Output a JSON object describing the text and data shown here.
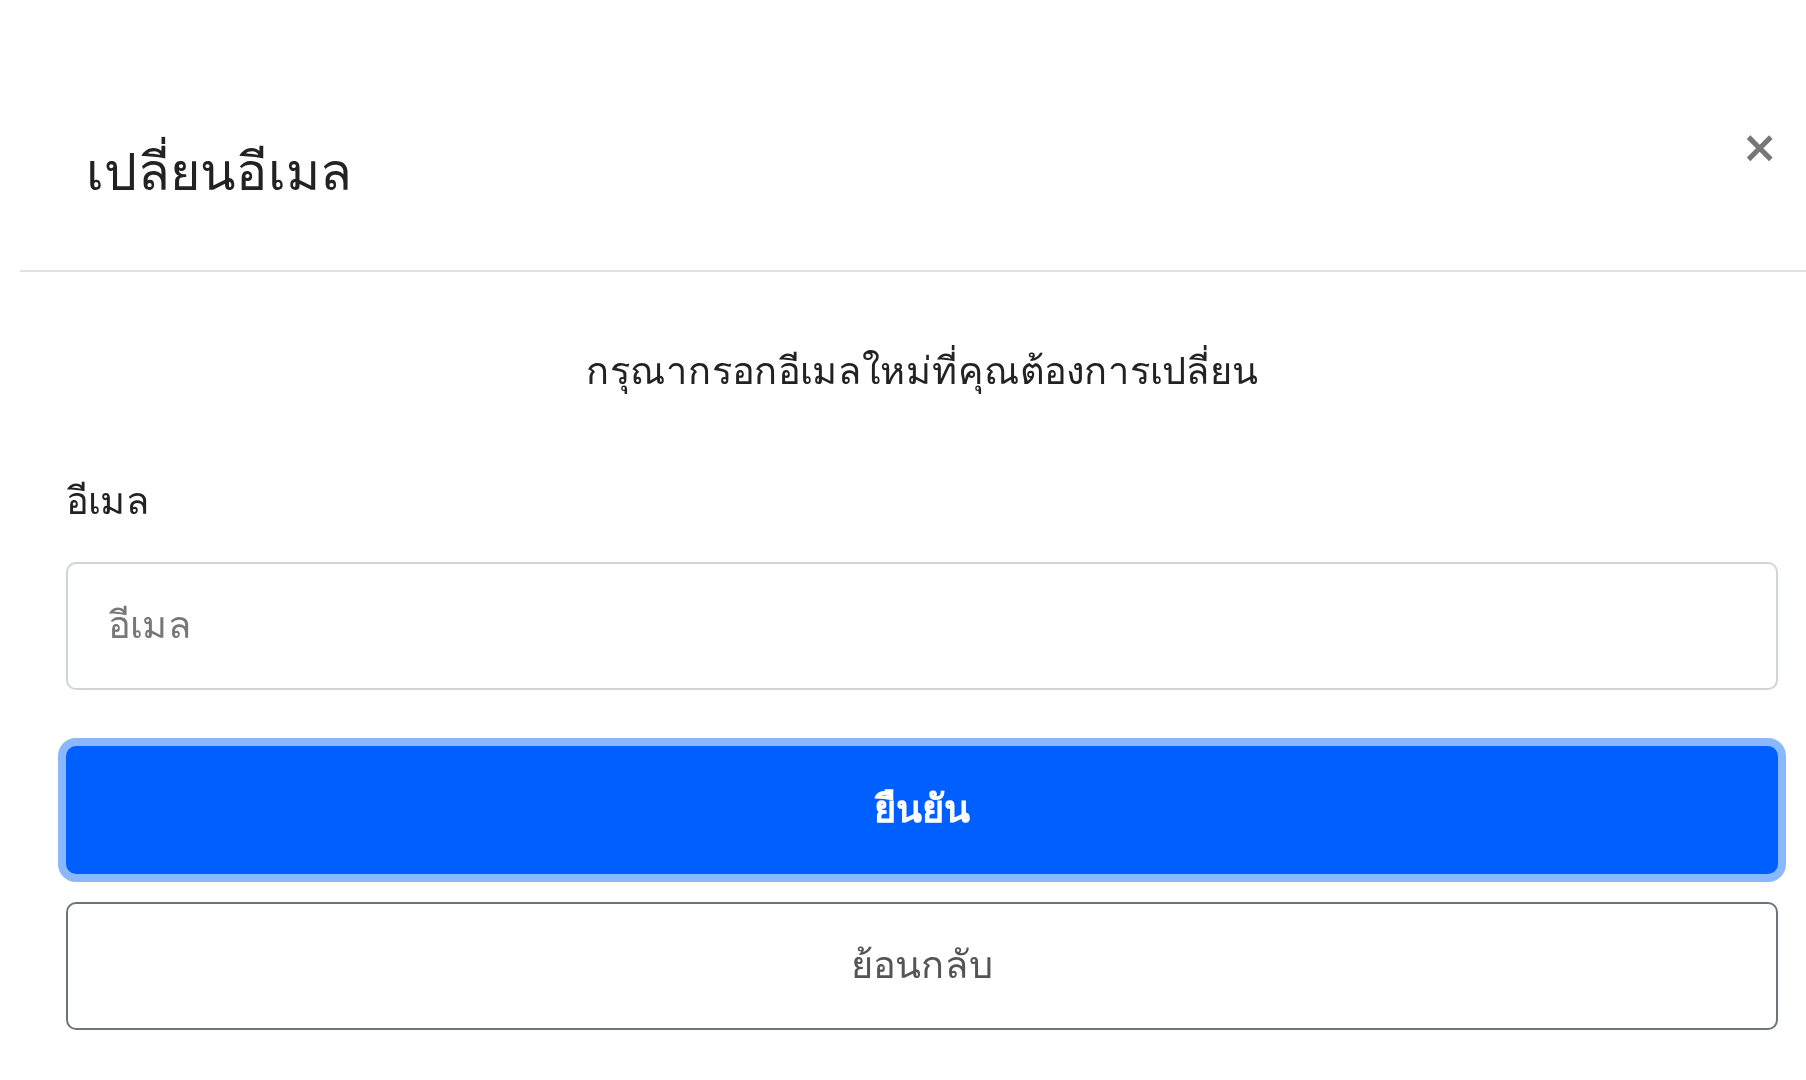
{
  "dialog": {
    "title": "เปลี่ยนอีเมล",
    "close": "×",
    "instruction": "กรุณากรอกอีเมลใหม่ที่คุณต้องการเปลี่ยน",
    "field": {
      "label": "อีเมล",
      "placeholder": "อีเมล"
    },
    "buttons": [
      {
        "label": "ยืนยัน",
        "kind": "primary",
        "focused": true
      },
      {
        "label": "ย้อนกลับ",
        "kind": "secondary",
        "focused": false
      }
    ]
  }
}
